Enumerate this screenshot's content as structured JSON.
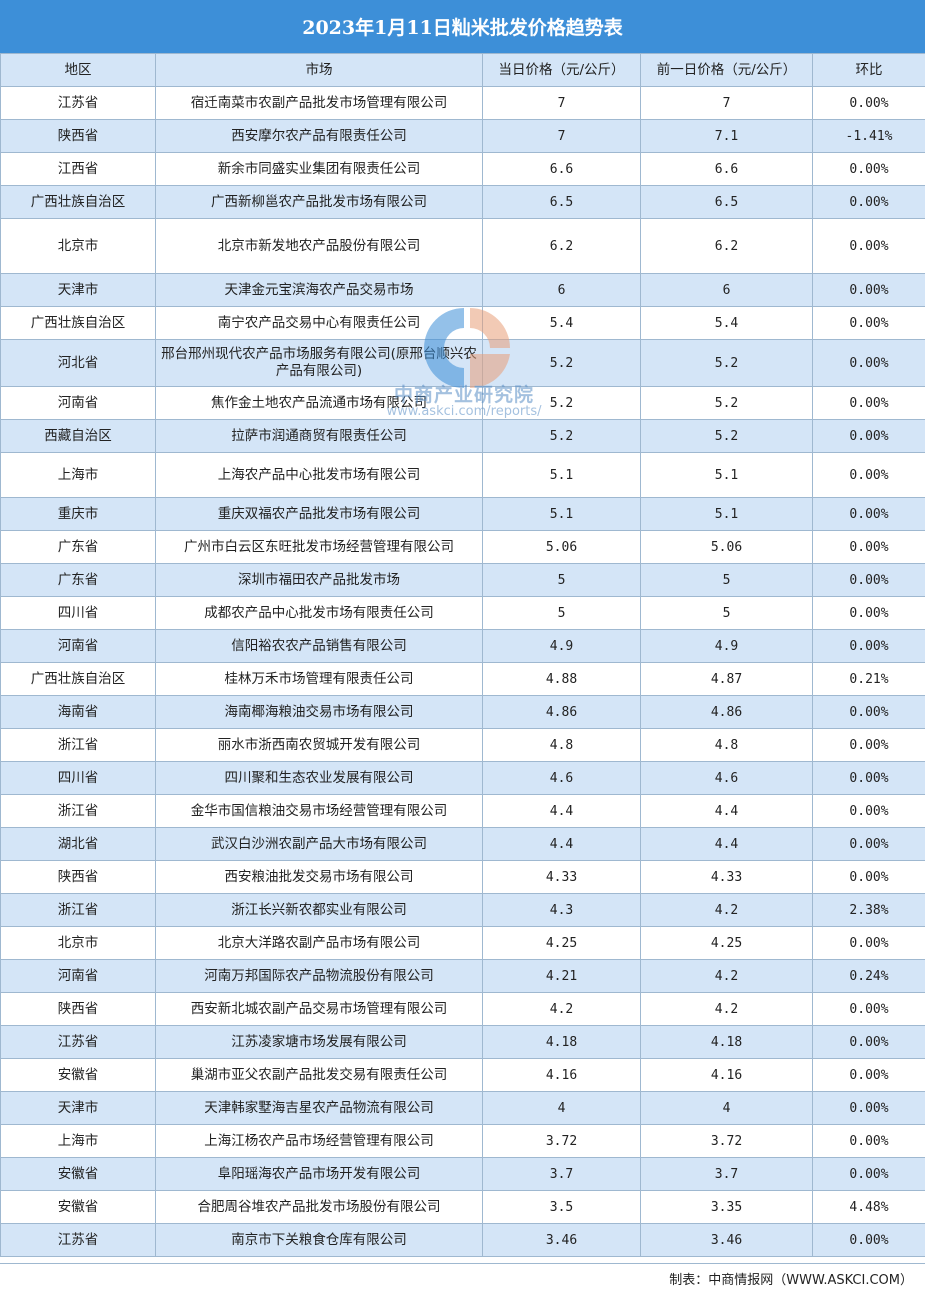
{
  "title": "2023年1月11日籼米批发价格趋势表",
  "columns": [
    "地区",
    "市场",
    "当日价格（元/公斤）",
    "前一日价格（元/公斤）",
    "环比"
  ],
  "rows": [
    [
      "江苏省",
      "宿迁南菜市农副产品批发市场管理有限公司",
      "7",
      "7",
      "0.00%"
    ],
    [
      "陕西省",
      "西安摩尔农产品有限责任公司",
      "7",
      "7.1",
      "-1.41%"
    ],
    [
      "江西省",
      "新余市同盛实业集团有限责任公司",
      "6.6",
      "6.6",
      "0.00%"
    ],
    [
      "广西壮族自治区",
      "广西新柳邕农产品批发市场有限公司",
      "6.5",
      "6.5",
      "0.00%"
    ],
    [
      "北京市",
      "北京市新发地农产品股份有限公司",
      "6.2",
      "6.2",
      "0.00%"
    ],
    [
      "天津市",
      "天津金元宝滨海农产品交易市场",
      "6",
      "6",
      "0.00%"
    ],
    [
      "广西壮族自治区",
      "南宁农产品交易中心有限责任公司",
      "5.4",
      "5.4",
      "0.00%"
    ],
    [
      "河北省",
      "邢台邢州现代农产品市场服务有限公司(原邢台顺兴农产品有限公司)",
      "5.2",
      "5.2",
      "0.00%"
    ],
    [
      "河南省",
      "焦作金土地农产品流通市场有限公司",
      "5.2",
      "5.2",
      "0.00%"
    ],
    [
      "西藏自治区",
      "拉萨市润通商贸有限责任公司",
      "5.2",
      "5.2",
      "0.00%"
    ],
    [
      "上海市",
      "上海农产品中心批发市场有限公司",
      "5.1",
      "5.1",
      "0.00%"
    ],
    [
      "重庆市",
      "重庆双福农产品批发市场有限公司",
      "5.1",
      "5.1",
      "0.00%"
    ],
    [
      "广东省",
      "广州市白云区东旺批发市场经营管理有限公司",
      "5.06",
      "5.06",
      "0.00%"
    ],
    [
      "广东省",
      "深圳市福田农产品批发市场",
      "5",
      "5",
      "0.00%"
    ],
    [
      "四川省",
      "成都农产品中心批发市场有限责任公司",
      "5",
      "5",
      "0.00%"
    ],
    [
      "河南省",
      "信阳裕农农产品销售有限公司",
      "4.9",
      "4.9",
      "0.00%"
    ],
    [
      "广西壮族自治区",
      "桂林万禾市场管理有限责任公司",
      "4.88",
      "4.87",
      "0.21%"
    ],
    [
      "海南省",
      "海南椰海粮油交易市场有限公司",
      "4.86",
      "4.86",
      "0.00%"
    ],
    [
      "浙江省",
      "丽水市浙西南农贸城开发有限公司",
      "4.8",
      "4.8",
      "0.00%"
    ],
    [
      "四川省",
      "四川聚和生态农业发展有限公司",
      "4.6",
      "4.6",
      "0.00%"
    ],
    [
      "浙江省",
      "金华市国信粮油交易市场经营管理有限公司",
      "4.4",
      "4.4",
      "0.00%"
    ],
    [
      "湖北省",
      "武汉白沙洲农副产品大市场有限公司",
      "4.4",
      "4.4",
      "0.00%"
    ],
    [
      "陕西省",
      "西安粮油批发交易市场有限公司",
      "4.33",
      "4.33",
      "0.00%"
    ],
    [
      "浙江省",
      "浙江长兴新农都实业有限公司",
      "4.3",
      "4.2",
      "2.38%"
    ],
    [
      "北京市",
      "北京大洋路农副产品市场有限公司",
      "4.25",
      "4.25",
      "0.00%"
    ],
    [
      "河南省",
      "河南万邦国际农产品物流股份有限公司",
      "4.21",
      "4.2",
      "0.24%"
    ],
    [
      "陕西省",
      "西安新北城农副产品交易市场管理有限公司",
      "4.2",
      "4.2",
      "0.00%"
    ],
    [
      "江苏省",
      "江苏凌家塘市场发展有限公司",
      "4.18",
      "4.18",
      "0.00%"
    ],
    [
      "安徽省",
      "巢湖市亚父农副产品批发交易有限责任公司",
      "4.16",
      "4.16",
      "0.00%"
    ],
    [
      "天津市",
      "天津韩家墅海吉星农产品物流有限公司",
      "4",
      "4",
      "0.00%"
    ],
    [
      "上海市",
      "上海江杨农产品市场经营管理有限公司",
      "3.72",
      "3.72",
      "0.00%"
    ],
    [
      "安徽省",
      "阜阳瑶海农产品市场开发有限公司",
      "3.7",
      "3.7",
      "0.00%"
    ],
    [
      "安徽省",
      "合肥周谷堆农产品批发市场股份有限公司",
      "3.5",
      "3.35",
      "4.48%"
    ],
    [
      "江苏省",
      "南京市下关粮食仓库有限公司",
      "3.46",
      "3.46",
      "0.00%"
    ]
  ],
  "footer": "制表：中商情报网（WWW.ASKCI.COM）",
  "watermark": {
    "name": "中商产业研究院",
    "url": "www.askci.com/reports/"
  },
  "colors": {
    "header_blue": "#3d8fd8",
    "stripe_blue": "#d4e5f7",
    "border": "#9fb8d0"
  }
}
